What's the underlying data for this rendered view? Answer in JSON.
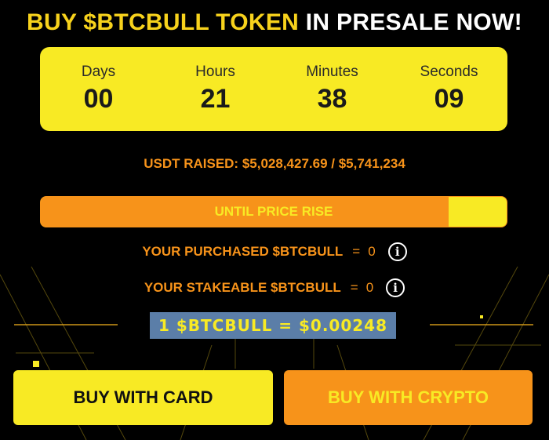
{
  "header": {
    "title_highlight": "BUY $BTCBULL TOKEN",
    "title_rest": "IN PRESALE NOW!"
  },
  "countdown": [
    {
      "label": "Days",
      "value": "00"
    },
    {
      "label": "Hours",
      "value": "21"
    },
    {
      "label": "Minutes",
      "value": "38"
    },
    {
      "label": "Seconds",
      "value": "09"
    }
  ],
  "raised": {
    "text": "USDT RAISED: $5,028,427.69 / $5,741,234"
  },
  "progress": {
    "label": "UNTIL PRICE RISE",
    "percent": 87.6
  },
  "purchased": {
    "label": "YOUR PURCHASED $BTCBULL",
    "eq": "=",
    "value": "0"
  },
  "stakeable": {
    "label": "YOUR STAKEABLE $BTCBULL",
    "eq": "=",
    "value": "0"
  },
  "info_icon_glyph": "i",
  "rate": {
    "text": "1 $BTCBULL = $0.00248"
  },
  "buttons": {
    "card": "BUY WITH CARD",
    "crypto": "BUY WITH CRYPTO"
  },
  "colors": {
    "yellow": "#f8ea24",
    "orange": "#f7931a",
    "background": "#000000"
  }
}
